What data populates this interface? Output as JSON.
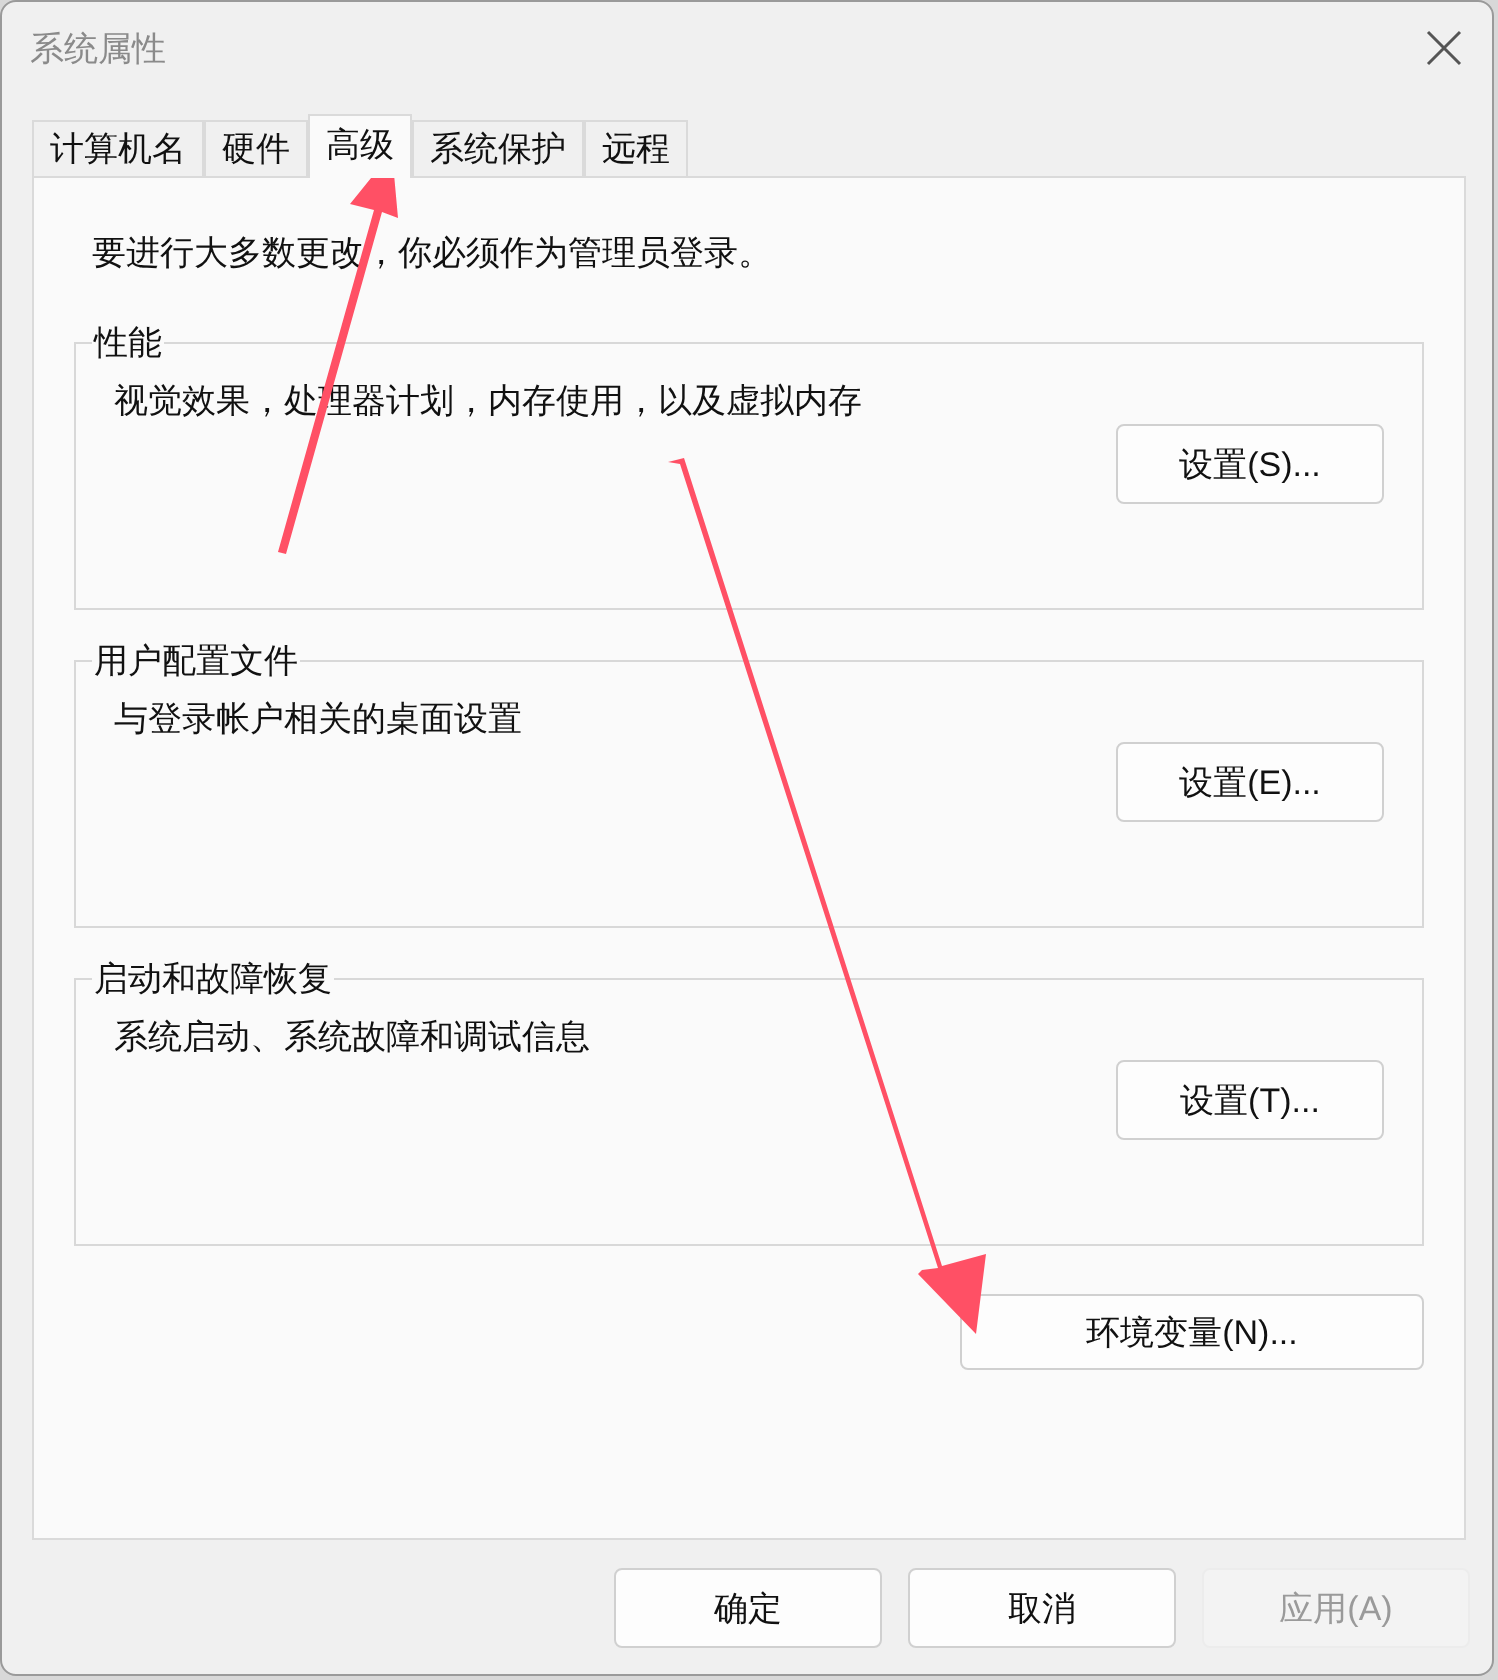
{
  "window": {
    "title": "系统属性"
  },
  "tabs": [
    {
      "label": "计算机名",
      "selected": false
    },
    {
      "label": "硬件",
      "selected": false
    },
    {
      "label": "高级",
      "selected": true
    },
    {
      "label": "系统保护",
      "selected": false
    },
    {
      "label": "远程",
      "selected": false
    }
  ],
  "intro": "要进行大多数更改，你必须作为管理员登录。",
  "groups": [
    {
      "title": "性能",
      "description": "视觉效果，处理器计划，内存使用，以及虚拟内存",
      "button": "设置(S)..."
    },
    {
      "title": "用户配置文件",
      "description": "与登录帐户相关的桌面设置",
      "button": "设置(E)..."
    },
    {
      "title": "启动和故障恢复",
      "description": "系统启动、系统故障和调试信息",
      "button": "设置(T)..."
    }
  ],
  "env_button": "环境变量(N)...",
  "buttons": [
    {
      "label": "确定",
      "disabled": false
    },
    {
      "label": "取消",
      "disabled": false
    },
    {
      "label": "应用(A)",
      "disabled": true
    }
  ]
}
